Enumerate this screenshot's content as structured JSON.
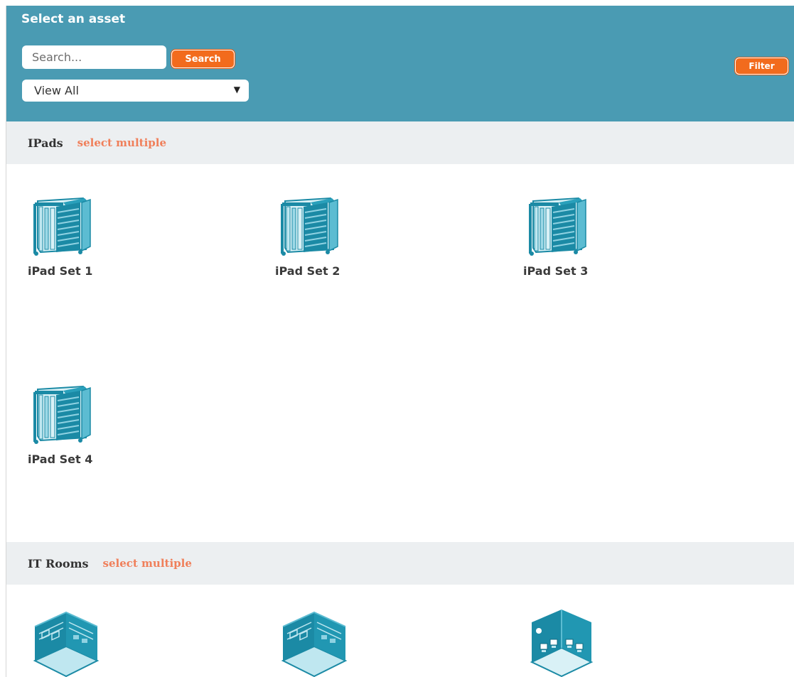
{
  "header": {
    "title": "Select an asset",
    "search_placeholder": "Search...",
    "search_button": "Search",
    "filter_button": "Filter",
    "view_select": "View All"
  },
  "sections": [
    {
      "title": "IPads",
      "select_multiple": "select multiple",
      "items": [
        {
          "label": "iPad Set 1",
          "icon": "ipad-cart-icon"
        },
        {
          "label": "iPad Set 2",
          "icon": "ipad-cart-icon"
        },
        {
          "label": "iPad Set 3",
          "icon": "ipad-cart-icon"
        },
        {
          "label": "iPad Set 4",
          "icon": "ipad-cart-icon"
        }
      ]
    },
    {
      "title": "IT Rooms",
      "select_multiple": "select multiple",
      "items": [
        {
          "label": "",
          "icon": "it-room-icon"
        },
        {
          "label": "",
          "icon": "it-room-icon"
        },
        {
          "label": "",
          "icon": "computer-room-icon"
        }
      ]
    }
  ],
  "colors": {
    "header_bg": "#4a9bb3",
    "button_orange": "#f26b1d",
    "section_bg": "#eceff1",
    "link_salmon": "#f07f5a",
    "icon_teal": "#1b8aa5"
  }
}
